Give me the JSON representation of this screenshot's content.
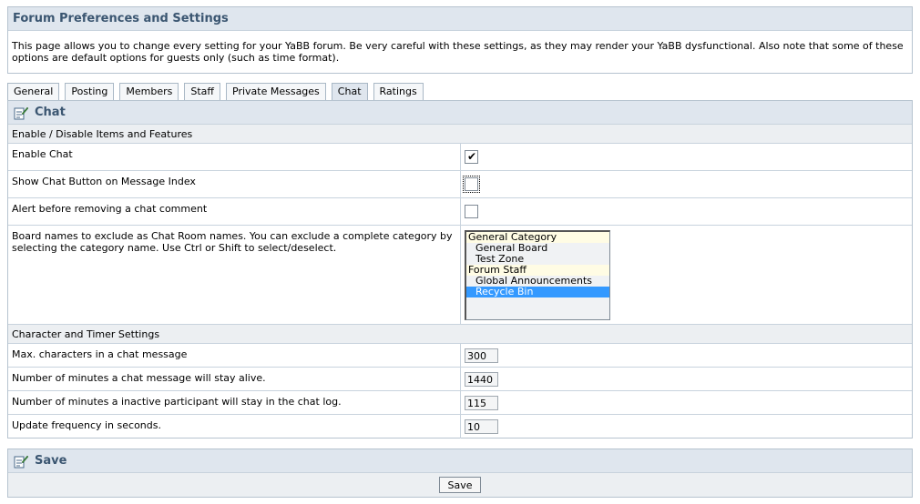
{
  "header": {
    "title": "Forum Preferences and Settings",
    "intro": "This page allows you to change every setting for your YaBB forum. Be very careful with these settings, as they may render your YaBB dysfunctional. Also note that some of these options are default options for guests only (such as time format)."
  },
  "tabs": [
    {
      "label": "General"
    },
    {
      "label": "Posting"
    },
    {
      "label": "Members"
    },
    {
      "label": "Staff"
    },
    {
      "label": "Private Messages"
    },
    {
      "label": "Chat",
      "active": true
    },
    {
      "label": "Ratings"
    }
  ],
  "chat": {
    "title": "Chat",
    "icon": "edit-settings-icon",
    "sections": {
      "enable": "Enable / Disable Items and Features",
      "timer": "Character and Timer Settings"
    },
    "enable_chat": {
      "label": "Enable Chat",
      "checked": true
    },
    "show_button": {
      "label": "Show Chat Button on Message Index",
      "checked": false
    },
    "alert_remove": {
      "label": "Alert before removing a chat comment",
      "checked": false
    },
    "exclude": {
      "label": "Board names to exclude as Chat Room names. You can exclude a complete category by selecting the category name. Use Ctrl or Shift to select/deselect.",
      "options": [
        {
          "text": "General Category",
          "type": "category"
        },
        {
          "text": "General Board",
          "type": "board"
        },
        {
          "text": "Test Zone",
          "type": "board"
        },
        {
          "text": "Forum Staff",
          "type": "category"
        },
        {
          "text": "Global Announcements",
          "type": "board"
        },
        {
          "text": "Recycle Bin",
          "type": "board",
          "selected": true
        }
      ]
    },
    "max_chars": {
      "label": "Max. characters in a chat message",
      "value": "300"
    },
    "msg_alive": {
      "label": "Number of minutes a chat message will stay alive.",
      "value": "1440"
    },
    "inactive": {
      "label": "Number of minutes a inactive participant will stay in the chat log.",
      "value": "115"
    },
    "update_freq": {
      "label": "Update frequency in seconds.",
      "value": "10"
    }
  },
  "save": {
    "title": "Save",
    "button": "Save"
  },
  "colors": {
    "header_bg": "#dfe6ee",
    "header_text": "#3b5671",
    "border": "#b6c3cf",
    "selected": "#3399ff"
  }
}
